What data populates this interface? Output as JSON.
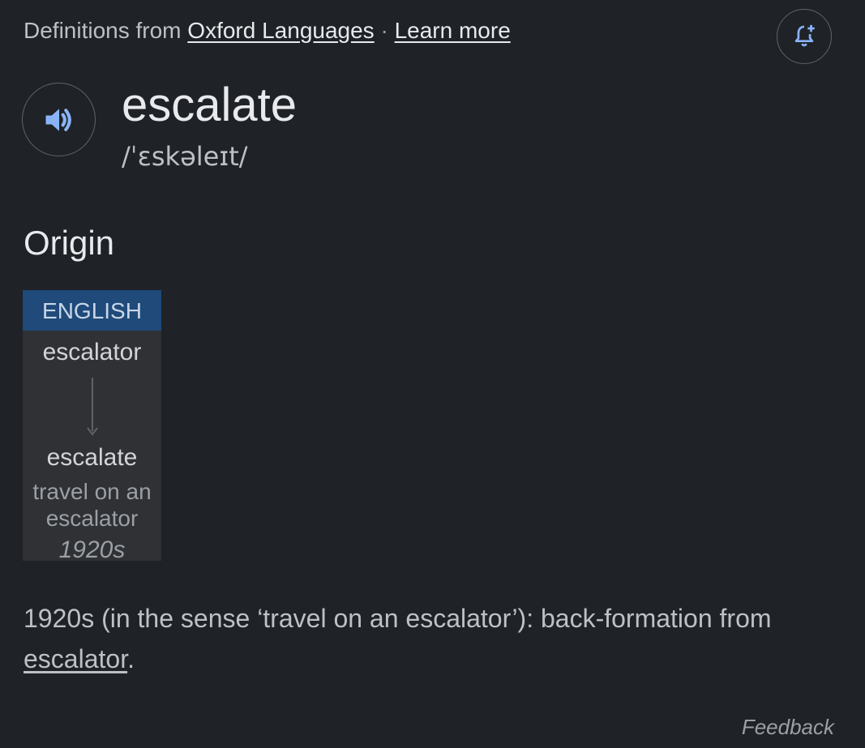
{
  "source": {
    "prefix": "Definitions from",
    "provider_link": "Oxford Languages",
    "separator": "·",
    "learn_more": "Learn more"
  },
  "entry": {
    "word": "escalate",
    "phonetic": "/ˈɛskəleɪt/"
  },
  "origin": {
    "heading": "Origin",
    "diagram": {
      "language": "ENGLISH",
      "source_word": "escalator",
      "target_word": "escalate",
      "sense": "travel on an escalator",
      "date": "1920s"
    },
    "text_before": "1920s (in the sense ‘travel on an escalator’): back-formation from ",
    "link": "escalator",
    "text_after": "."
  },
  "feedback": "Feedback",
  "colors": {
    "background": "#1f2226",
    "accent_icon": "#8ab4f8",
    "lang_banner": "#1f4a7a"
  },
  "icons": {
    "alert": "add-alert-icon",
    "audio": "speaker-icon",
    "arrow": "arrow-down-icon"
  }
}
